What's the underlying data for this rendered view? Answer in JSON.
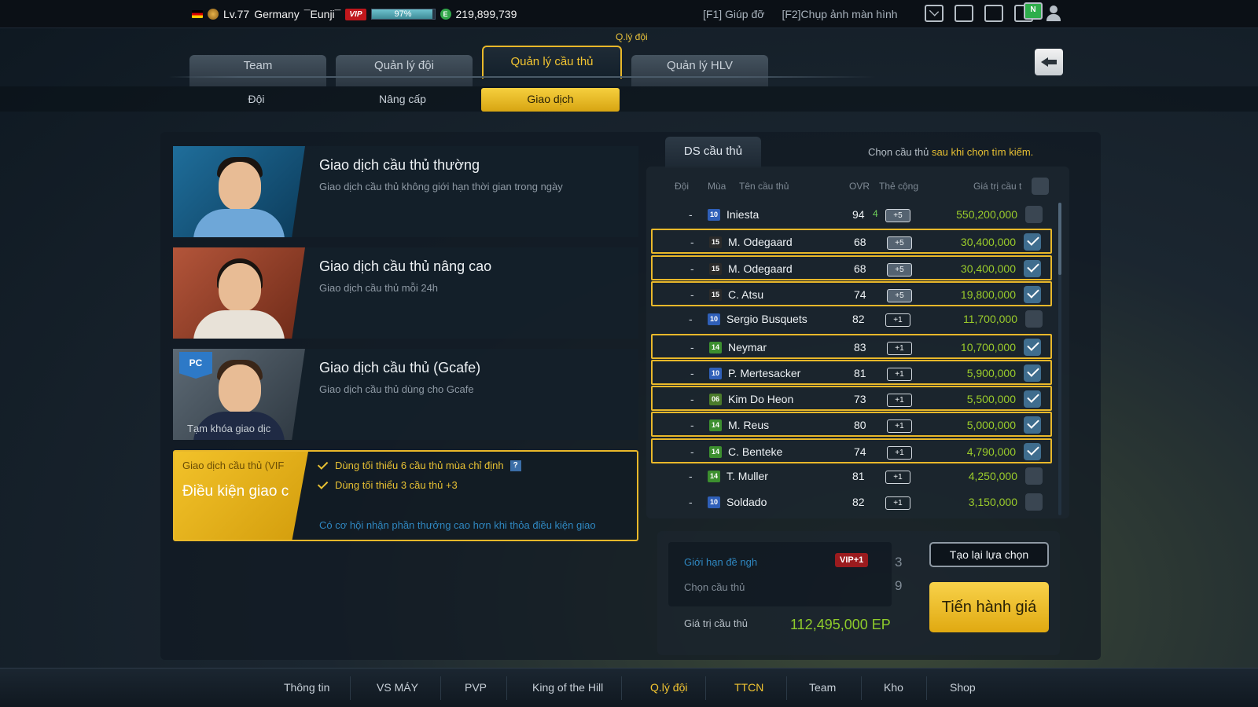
{
  "topbar": {
    "level": "Lv.77",
    "team_name": "Germany",
    "username": "¯Eunji¯",
    "vip": "VIP",
    "exp_percent": "97%",
    "exp_fraction": 0.97,
    "coins": "219,899,739",
    "coin_symbol": "E",
    "help": "[F1] Giúp đỡ",
    "screenshot": "[F2]Chụp ảnh màn hình",
    "notif_badge": "N"
  },
  "breadcrumb": "Q.lý đội",
  "tabs": [
    "Team",
    "Quản lý đội",
    "Quản lý cầu thủ",
    "Quản lý HLV"
  ],
  "subtabs": [
    "Đội",
    "Nâng cấp",
    "Giao dịch"
  ],
  "trade_options": [
    {
      "title": "Giao dịch cầu thủ thường",
      "desc": "Giao dịch cầu thủ không giới hạn thời gian trong ngày"
    },
    {
      "title": "Giao dịch cầu thủ nâng cao",
      "desc": "Giao dịch cầu thủ mỗi 24h"
    },
    {
      "title": "Giao dịch cầu thủ (Gcafe)",
      "desc": "Giao dịch cầu thủ dùng cho Gcafe",
      "badge": "PC",
      "lock_note": "Tạm khóa giao dịc"
    }
  ],
  "vip_trade": {
    "label": "Giao dịch cầu thủ (VIF",
    "title": "Điều kiện giao c",
    "conditions": [
      "Dùng tối thiểu 6 cầu thủ mùa chỉ định",
      "Dùng tối thiểu 3 cầu thủ +3"
    ],
    "help_icon": "?",
    "hint": "Có cơ hội nhận phần thưởng cao hơn khi thỏa điều kiện giao"
  },
  "player_list": {
    "tab": "DS cầu thủ",
    "hint_a": "Chọn cầu thủ ",
    "hint_b": "sau khi chọn tìm kiếm.",
    "headers": {
      "team": "Đội",
      "season": "Mùa",
      "name": "Tên cầu thủ",
      "ovr": "OVR",
      "upgrade": "Thẻ cộng",
      "value": "Giá trị cầu t"
    },
    "rows": [
      {
        "team": "-",
        "season": "10",
        "name": "Iniesta",
        "ovr": "94",
        "ovr_boost": "4",
        "upgrade": "+5",
        "value": "550,200,000",
        "selected": false
      },
      {
        "team": "-",
        "season": "15",
        "name": "M. Odegaard",
        "ovr": "68",
        "ovr_boost": "",
        "upgrade": "+5",
        "value": "30,400,000",
        "selected": true
      },
      {
        "team": "-",
        "season": "15",
        "name": "M. Odegaard",
        "ovr": "68",
        "ovr_boost": "",
        "upgrade": "+5",
        "value": "30,400,000",
        "selected": true
      },
      {
        "team": "-",
        "season": "15",
        "name": "C. Atsu",
        "ovr": "74",
        "ovr_boost": "",
        "upgrade": "+5",
        "value": "19,800,000",
        "selected": true
      },
      {
        "team": "-",
        "season": "10",
        "name": "Sergio Busquets",
        "ovr": "82",
        "ovr_boost": "",
        "upgrade": "+1",
        "value": "11,700,000",
        "selected": false
      },
      {
        "team": "-",
        "season": "14",
        "name": "Neymar",
        "ovr": "83",
        "ovr_boost": "",
        "upgrade": "+1",
        "value": "10,700,000",
        "selected": true
      },
      {
        "team": "-",
        "season": "10",
        "name": "P. Mertesacker",
        "ovr": "81",
        "ovr_boost": "",
        "upgrade": "+1",
        "value": "5,900,000",
        "selected": true
      },
      {
        "team": "-",
        "season": "06",
        "name": "Kim Do Heon",
        "ovr": "73",
        "ovr_boost": "",
        "upgrade": "+1",
        "value": "5,500,000",
        "selected": true
      },
      {
        "team": "-",
        "season": "14",
        "name": "M. Reus",
        "ovr": "80",
        "ovr_boost": "",
        "upgrade": "+1",
        "value": "5,000,000",
        "selected": true
      },
      {
        "team": "-",
        "season": "14",
        "name": "C. Benteke",
        "ovr": "74",
        "ovr_boost": "",
        "upgrade": "+1",
        "value": "4,790,000",
        "selected": true
      },
      {
        "team": "-",
        "season": "14",
        "name": "T. Muller",
        "ovr": "81",
        "ovr_boost": "",
        "upgrade": "+1",
        "value": "4,250,000",
        "selected": false
      },
      {
        "team": "-",
        "season": "10",
        "name": "Soldado",
        "ovr": "82",
        "ovr_boost": "",
        "upgrade": "+1",
        "value": "3,150,000",
        "selected": false
      }
    ]
  },
  "summary": {
    "limit_label": "Giới hạn đề ngh",
    "vip_bonus": "VIP+1",
    "limit_value": "3",
    "chosen_label": "Chọn cầu thủ",
    "chosen_value": "9",
    "value_label": "Giá trị cầu thủ",
    "value": "112,495,000 EP",
    "reset_button": "Tạo lại lựa chọn",
    "go_button": "Tiến hành giá"
  },
  "bottom_nav": [
    "Thông tin",
    "VS MÁY",
    "PVP",
    "King of the Hill",
    "Q.lý đội",
    "TTCN",
    "Team",
    "Kho",
    "Shop"
  ],
  "season_colors": {
    "10": "#2f5fb8",
    "15": "#2a2a2a",
    "14": "#3c8f2f",
    "06": "#4b7b2b"
  }
}
